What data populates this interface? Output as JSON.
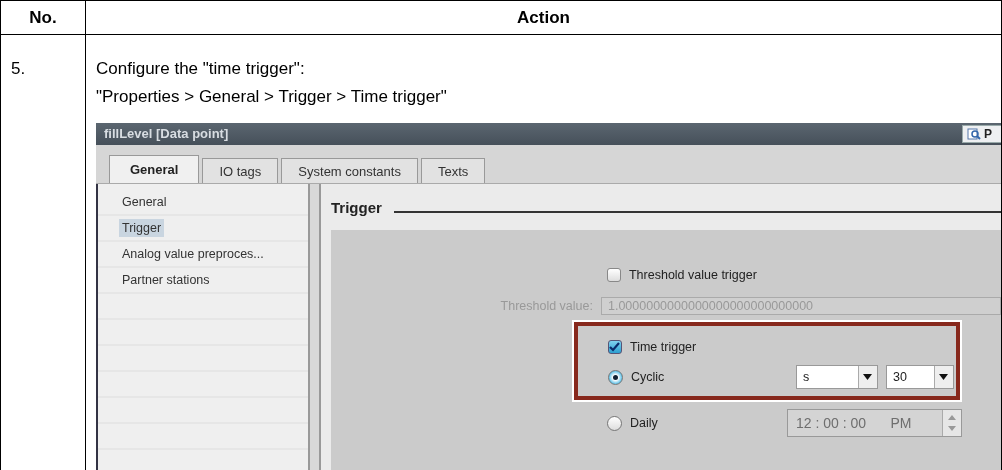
{
  "table": {
    "columns": [
      "No.",
      "Action"
    ],
    "rows": [
      {
        "number": "5.",
        "instruction": "Configure the \"time trigger\":",
        "path": "\"Properties > General > Trigger > Time trigger\""
      }
    ]
  },
  "screenshot": {
    "title": "fillLevel [Data point]",
    "title_button": "P",
    "tabs": [
      {
        "label": "General",
        "selected": true
      },
      {
        "label": "IO tags",
        "selected": false
      },
      {
        "label": "System constants",
        "selected": false
      },
      {
        "label": "Texts",
        "selected": false
      }
    ],
    "nav_items": [
      {
        "label": "General",
        "selected": false
      },
      {
        "label": "Trigger",
        "selected": true
      },
      {
        "label": "Analog value preproces...",
        "selected": false
      },
      {
        "label": "Partner stations",
        "selected": false
      }
    ],
    "section_title": "Trigger",
    "threshold_trigger": {
      "label": "Threshold value trigger",
      "checked": false
    },
    "threshold_value": {
      "label": "Threshold value:",
      "value": "1.0000000000000000000000000000",
      "disabled": true
    },
    "time_trigger": {
      "label": "Time trigger",
      "checked": true
    },
    "modes": [
      {
        "label": "Cyclic",
        "selected": true
      },
      {
        "label": "Daily",
        "selected": false
      }
    ],
    "cyclic_unit": "s",
    "cyclic_value": "30",
    "daily_time": {
      "time": "12 : 00 : 00",
      "period": "PM",
      "disabled": true
    },
    "highlight": true
  }
}
